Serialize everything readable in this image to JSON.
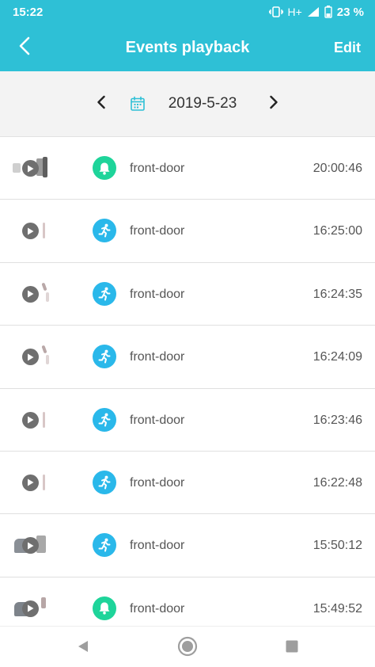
{
  "status_bar": {
    "time": "15:22",
    "network": "H+",
    "battery_percent": "23 %",
    "icons": [
      "vibrate-icon",
      "signal-icon",
      "battery-icon"
    ]
  },
  "header": {
    "title": "Events playback",
    "back_icon": "chevron-left-icon",
    "edit_label": "Edit",
    "background_color": "#2ec0d6"
  },
  "date_nav": {
    "date": "2019-5-23",
    "prev_icon": "chevron-left-icon",
    "next_icon": "chevron-right-icon",
    "calendar_icon": "calendar-icon"
  },
  "events": [
    {
      "type": "bell",
      "icon": "bell-icon",
      "name": "front-door",
      "time": "20:00:46"
    },
    {
      "type": "motion",
      "icon": "running-person-icon",
      "name": "front-door",
      "time": "16:25:00"
    },
    {
      "type": "motion",
      "icon": "running-person-icon",
      "name": "front-door",
      "time": "16:24:35"
    },
    {
      "type": "motion",
      "icon": "running-person-icon",
      "name": "front-door",
      "time": "16:24:09"
    },
    {
      "type": "motion",
      "icon": "running-person-icon",
      "name": "front-door",
      "time": "16:23:46"
    },
    {
      "type": "motion",
      "icon": "running-person-icon",
      "name": "front-door",
      "time": "16:22:48"
    },
    {
      "type": "motion",
      "icon": "running-person-icon",
      "name": "front-door",
      "time": "15:50:12"
    },
    {
      "type": "bell",
      "icon": "bell-icon",
      "name": "front-door",
      "time": "15:49:52"
    }
  ],
  "colors": {
    "bell": "#1ed49a",
    "motion": "#2ab8ea",
    "accent": "#2ec0d6"
  },
  "system_nav": [
    "back-triangle-icon",
    "home-circle-icon",
    "recents-square-icon"
  ]
}
